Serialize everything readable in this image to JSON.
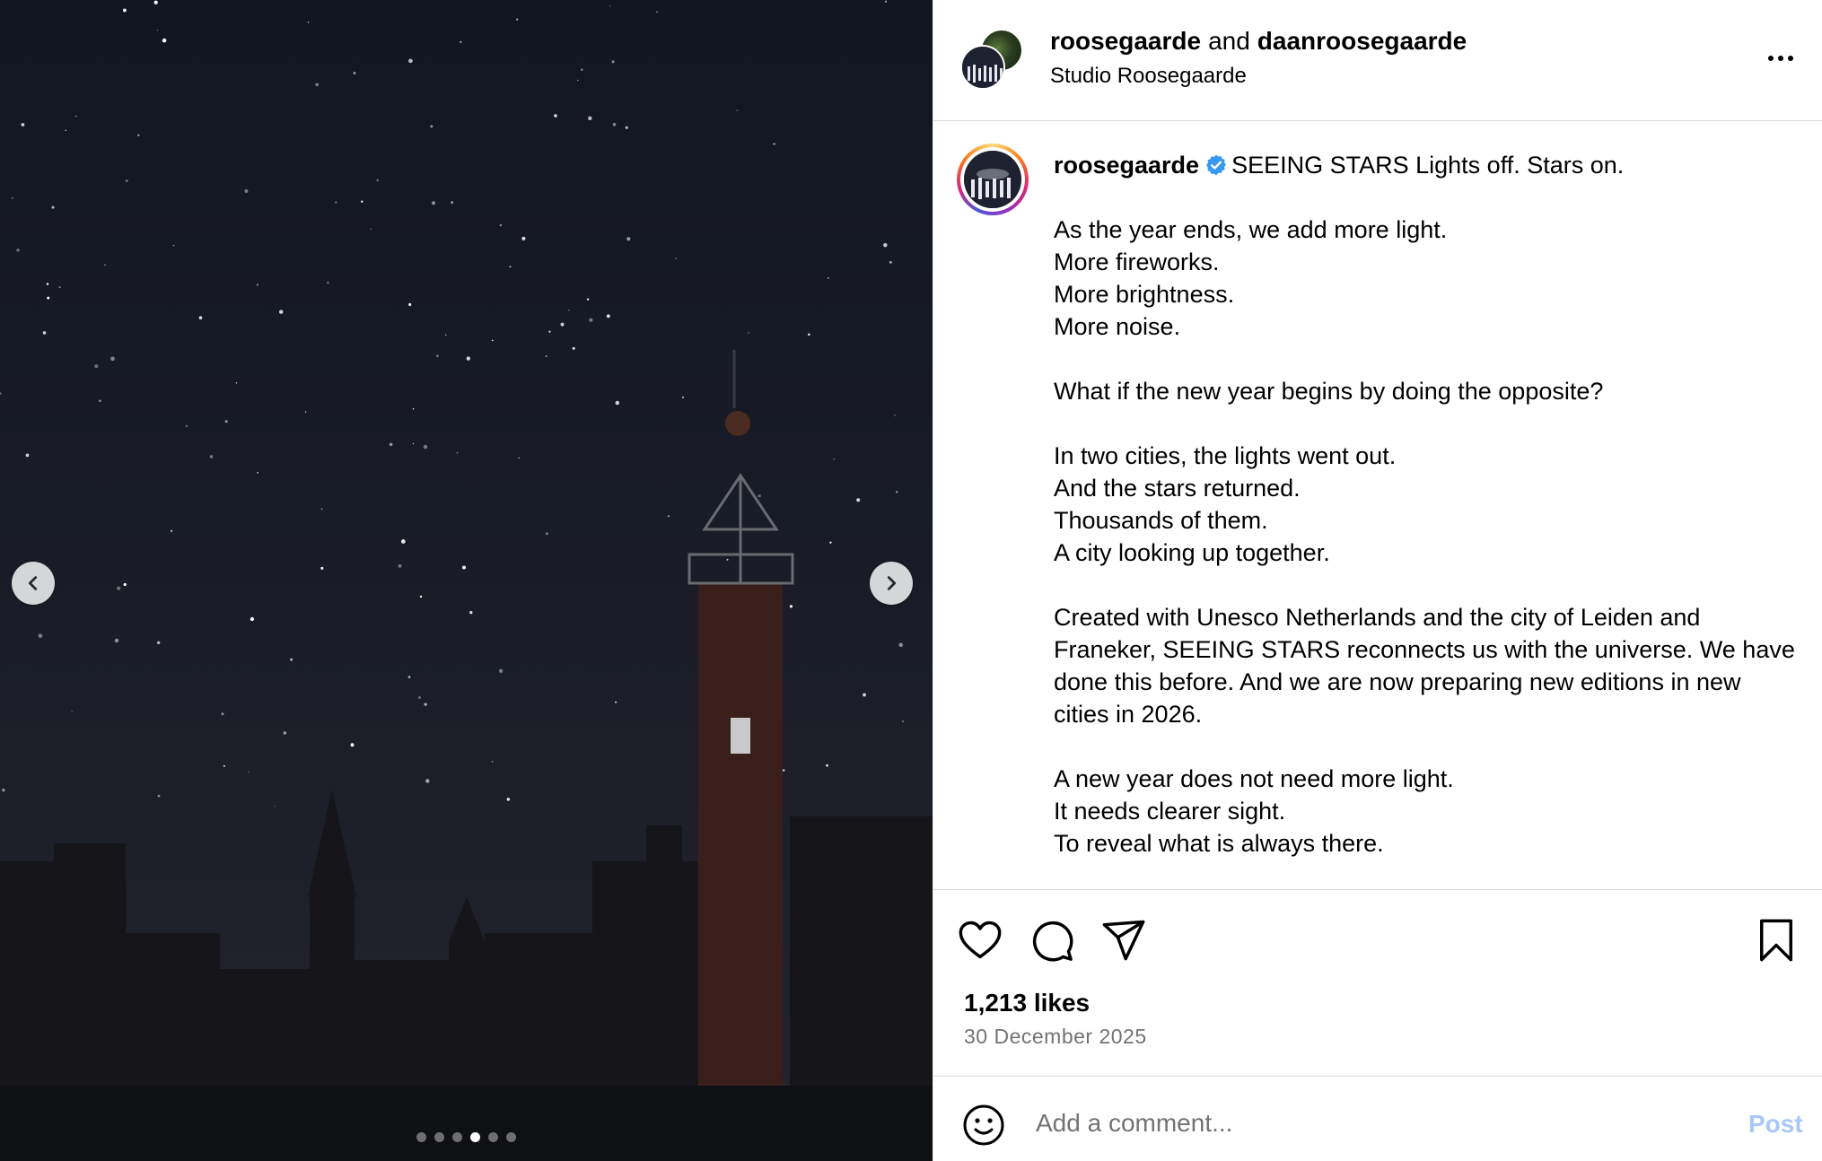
{
  "media": {
    "carousel_count": 6,
    "carousel_active_index": 3
  },
  "header": {
    "username_primary": "roosegaarde",
    "connector": "and",
    "username_collab": "daanroosegaarde",
    "subtitle": "Studio Roosegaarde",
    "more_icon": "more-horizontal-icon"
  },
  "caption": {
    "username": "roosegaarde",
    "verified_color": "#3897f0",
    "title": "SEEING STARS Lights off. Stars on.",
    "paragraphs": [
      [
        "As the year ends, we add more light.",
        "More fireworks.",
        "More brightness.",
        "More noise."
      ],
      [
        "What if the new year begins by doing the opposite?"
      ],
      [
        "In two cities, the lights went out.",
        "And the stars returned.",
        "Thousands of them.",
        "A city looking up together."
      ],
      [
        "Created with Unesco Netherlands and the city of Leiden and Franeker, SEEING STARS reconnects us with the universe. We have done this before. And we are now preparing new editions in new cities in 2026."
      ],
      [
        "A new year does not need more light.",
        "It needs clearer sight.",
        "To reveal what is always there."
      ]
    ]
  },
  "actions": {
    "icons": [
      "heart-icon",
      "comment-icon",
      "share-icon",
      "bookmark-icon"
    ],
    "likes": "1,213 likes",
    "date": "30 December 2025"
  },
  "comment": {
    "placeholder": "Add a comment...",
    "post_label": "Post",
    "post_color": "#a8c8f8"
  }
}
